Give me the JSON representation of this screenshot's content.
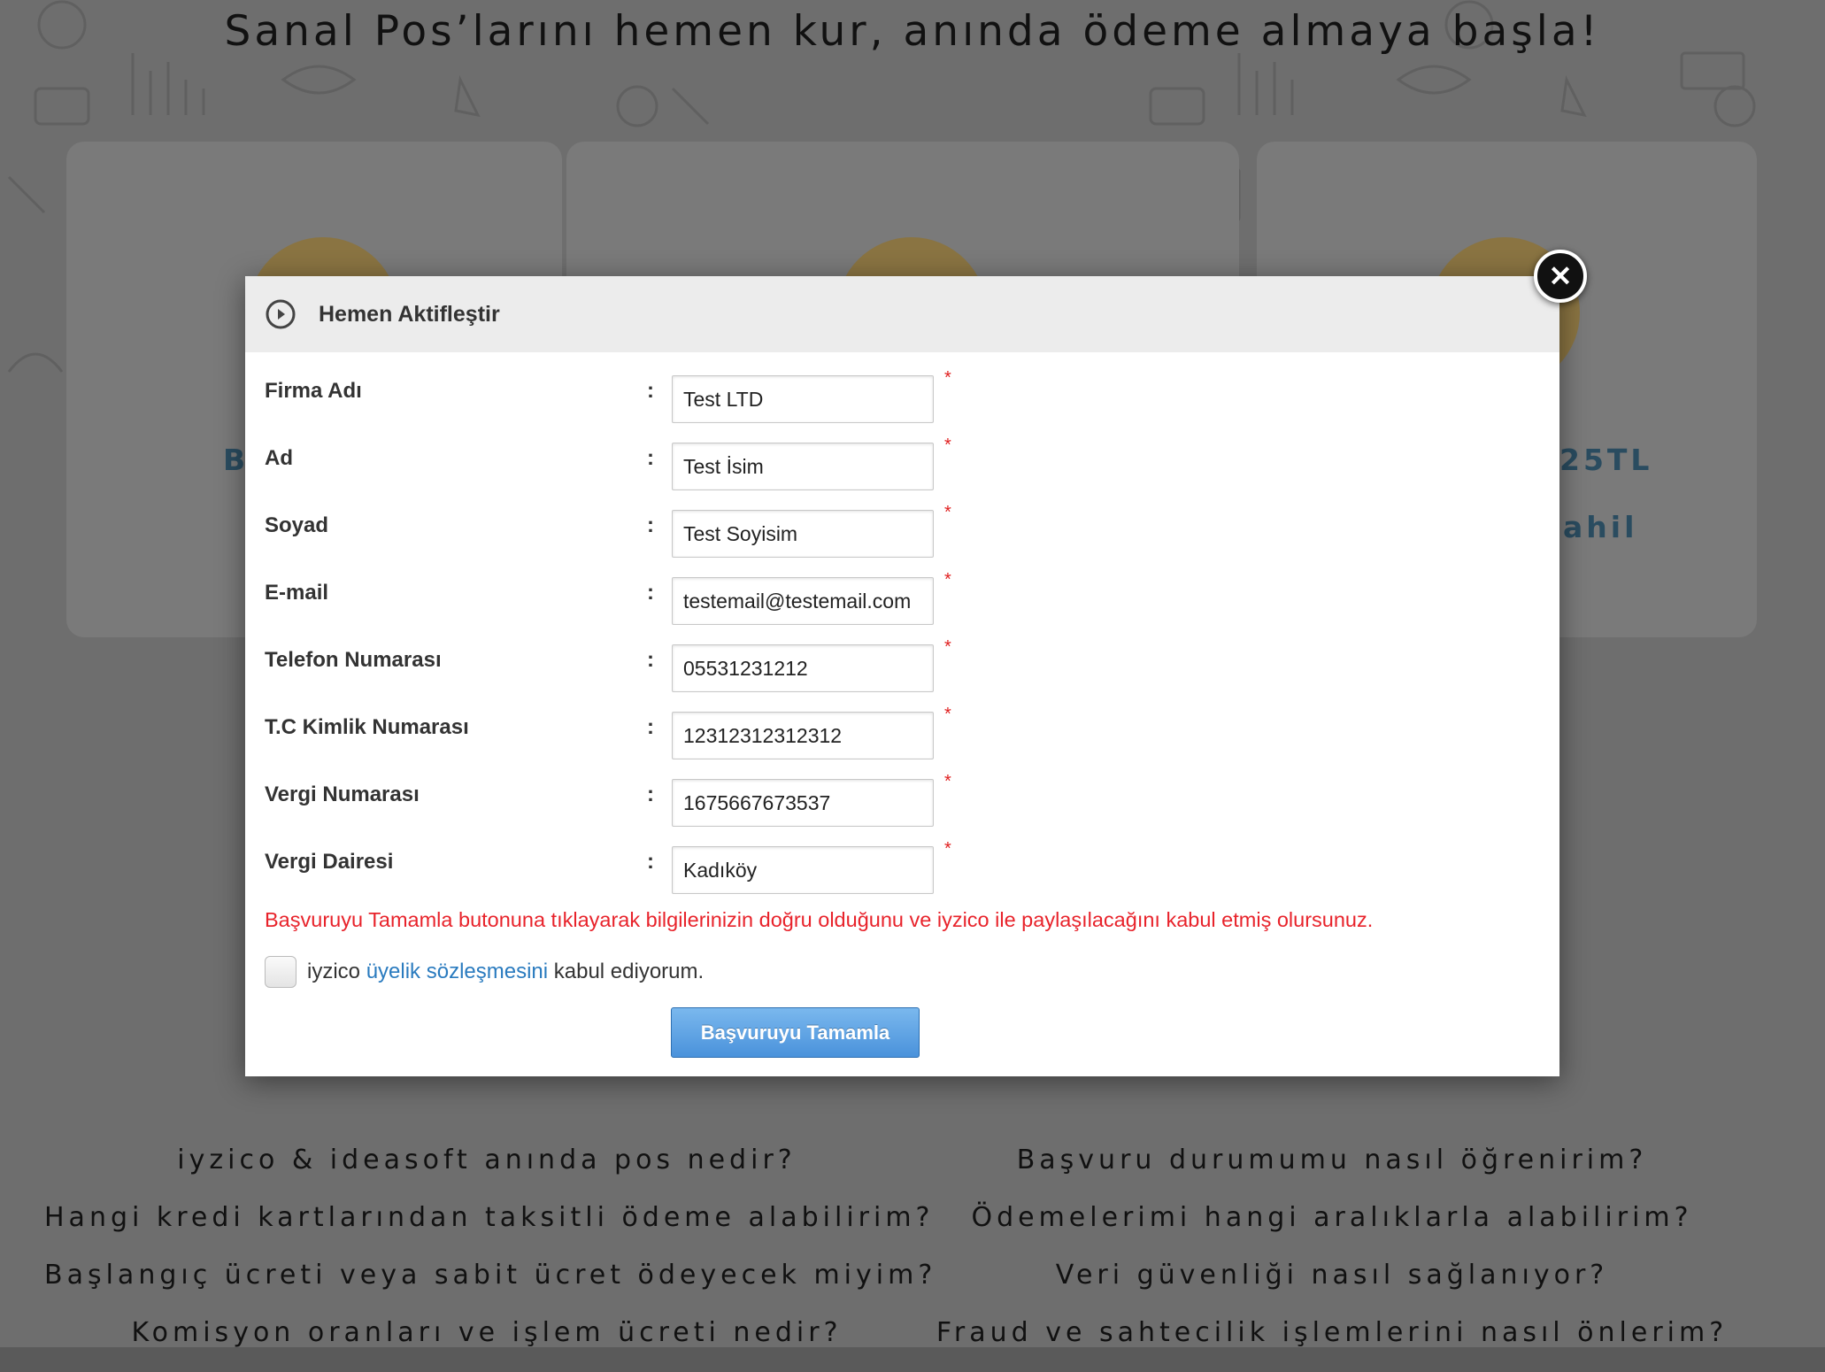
{
  "background": {
    "headline": "Sanal Pos’larını hemen kur, anında ödeme almaya başla!",
    "card_snippets": {
      "left": "B",
      "right_top": "25TL",
      "right_bottom": "ahil"
    },
    "faq_left": [
      "iyzico & ideasoft anında pos nedir?",
      "Hangi kredi kartlarından taksitli ödeme alabilirim?",
      "Başlangıç ücreti veya sabit ücret ödeyecek miyim?",
      "Komisyon oranları ve işlem ücreti nedir?"
    ],
    "faq_right": [
      "Başvuru durumumu nasıl öğrenirim?",
      "Ödemelerimi hangi aralıklarla alabilirim?",
      "Veri güvenliği nasıl sağlanıyor?",
      "Fraud ve sahtecilik işlemlerini nasıl önlerim?"
    ]
  },
  "modal": {
    "title": "Hemen Aktifleştir",
    "header_icon": "play-circle-icon",
    "close_icon": "close-icon",
    "close_glyph": "✕",
    "colon": ":",
    "required_marker": "*",
    "fields": [
      {
        "label": "Firma Adı",
        "value": "Test LTD"
      },
      {
        "label": "Ad",
        "value": "Test İsim"
      },
      {
        "label": "Soyad",
        "value": "Test Soyisim"
      },
      {
        "label": "E-mail",
        "value": "testemail@testemail.com"
      },
      {
        "label": "Telefon Numarası",
        "value": "05531231212"
      },
      {
        "label": "T.C Kimlik Numarası",
        "value": "12312312312312"
      },
      {
        "label": "Vergi Numarası",
        "value": "1675667673537"
      },
      {
        "label": "Vergi Dairesi",
        "value": "Kadıköy"
      }
    ],
    "notice": "Başvuruyu Tamamla butonuna tıklayarak bilgilerinizin doğru olduğunu ve iyzico ile paylaşılacağını kabul etmiş olursunuz.",
    "agreement": {
      "prefix": "iyzico ",
      "link": "üyelik sözleşmesini",
      "suffix": " kabul ediyorum.",
      "checked": false
    },
    "submit_label": "Başvuruyu Tamamla",
    "colors": {
      "notice": "#e8232b",
      "link": "#2a7bbf",
      "button": "#4a92db",
      "required": "#e02020"
    }
  }
}
